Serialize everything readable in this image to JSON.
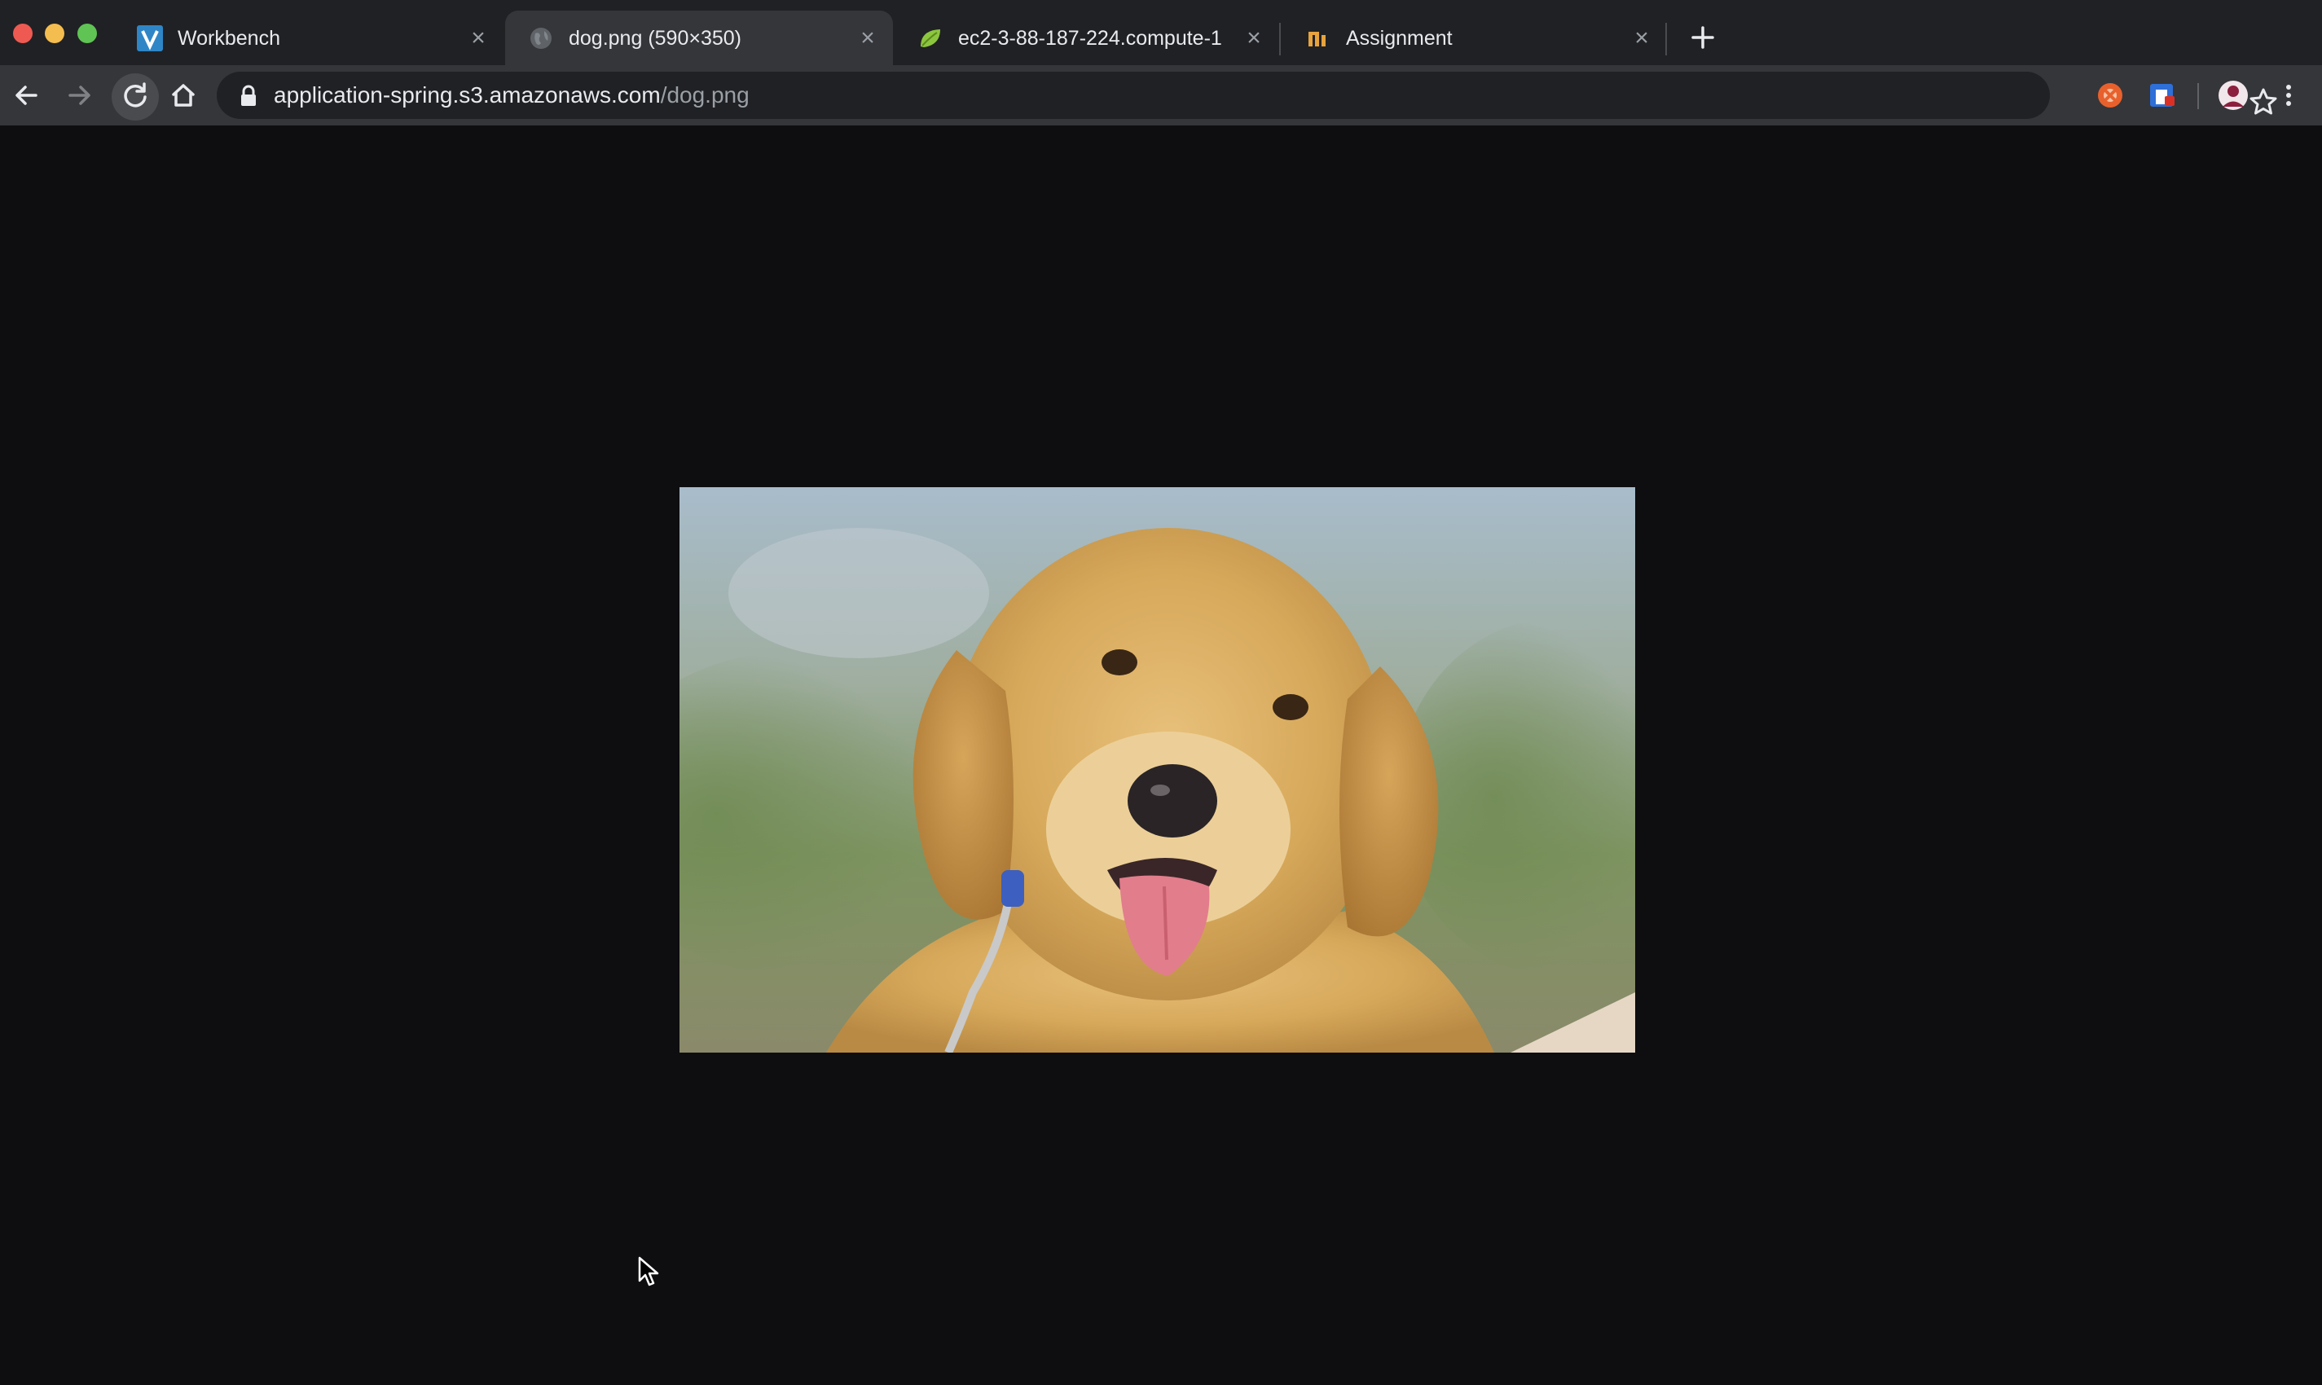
{
  "browser": {
    "tabs": [
      {
        "title": "Workbench",
        "favicon": "v-logo-icon",
        "active": false
      },
      {
        "title": "dog.png (590×350)",
        "favicon": "globe-icon",
        "active": true
      },
      {
        "title": "ec2-3-88-187-224.compute-1",
        "favicon": "spring-leaf-icon",
        "active": false
      },
      {
        "title": "Assignment",
        "favicon": "course-logo-icon",
        "active": false
      }
    ],
    "new_tab_icon": "plus-icon",
    "address": {
      "host": "application-spring.s3.amazonaws.com",
      "path": "/dog.png"
    },
    "nav_icons": [
      "back-arrow-icon",
      "forward-arrow-icon",
      "reload-icon",
      "home-icon"
    ],
    "extensions": [
      "orange-extension-icon",
      "blue-extension-icon",
      "profile-avatar",
      "more-menu-icon"
    ]
  },
  "content": {
    "background": "#0e0d10",
    "image_icon": "golden-retriever-puppy-photo"
  },
  "colors": {
    "chrome_dark": "#202124",
    "chrome_toolbar": "#35363a",
    "text_primary": "#e8eaed",
    "text_secondary": "#9aa0a6"
  }
}
